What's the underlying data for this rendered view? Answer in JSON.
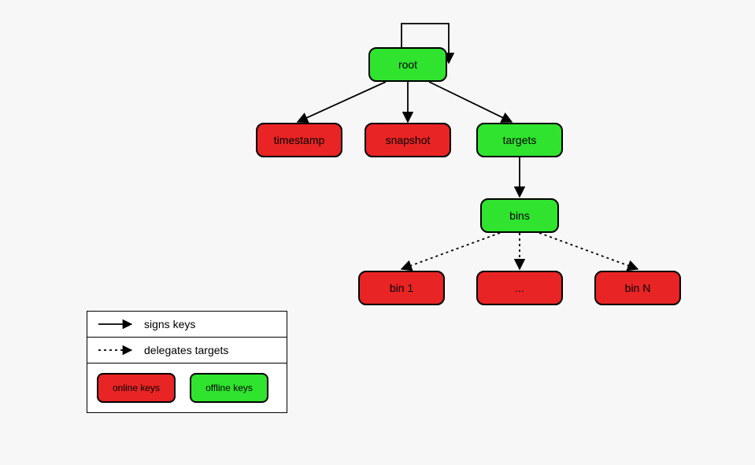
{
  "nodes": {
    "root": {
      "label": "root"
    },
    "timestamp": {
      "label": "timestamp"
    },
    "snapshot": {
      "label": "snapshot"
    },
    "targets": {
      "label": "targets"
    },
    "bins": {
      "label": "bins"
    },
    "bin1": {
      "label": "bin 1"
    },
    "binmid": {
      "label": "..."
    },
    "binN": {
      "label": "bin N"
    }
  },
  "legend": {
    "signs": "signs keys",
    "delegates": "delegates targets",
    "online": "online keys",
    "offline": "offline keys"
  },
  "edges": {
    "signs": [
      {
        "from": "root",
        "to": "root",
        "self": true
      },
      {
        "from": "root",
        "to": "timestamp"
      },
      {
        "from": "root",
        "to": "snapshot"
      },
      {
        "from": "root",
        "to": "targets"
      },
      {
        "from": "targets",
        "to": "bins"
      }
    ],
    "delegates": [
      {
        "from": "bins",
        "to": "bin1"
      },
      {
        "from": "bins",
        "to": "binmid"
      },
      {
        "from": "bins",
        "to": "binN"
      }
    ]
  },
  "colors": {
    "online": "#e82424",
    "offline": "#2fe32f"
  }
}
